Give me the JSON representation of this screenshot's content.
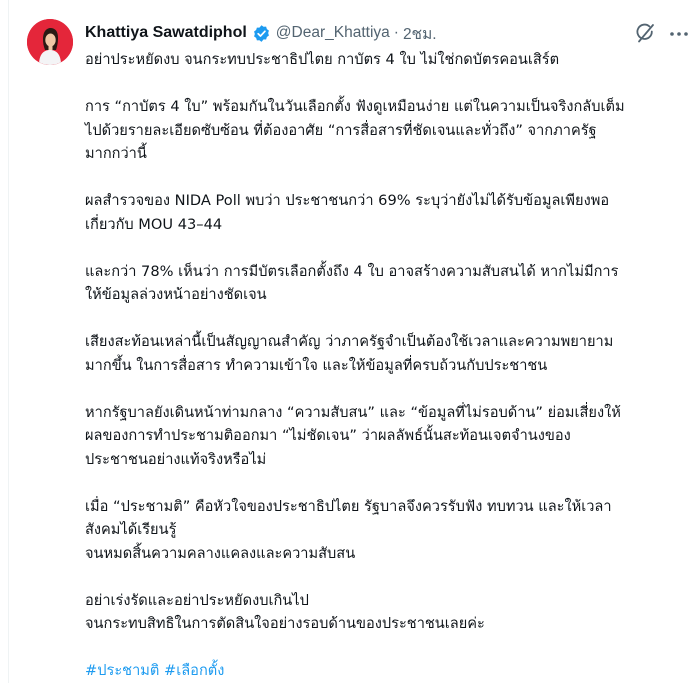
{
  "author": {
    "display_name": "Khattiya Sawatdiphol",
    "handle": "@Dear_Khattiya",
    "separator": "·",
    "time": "2ชม.",
    "verified_icon": "verified-badge-icon",
    "avatar_bg": "#e4263a"
  },
  "actions": {
    "grok_icon": "grok-icon",
    "more_icon": "more-icon"
  },
  "tweet": {
    "paragraphs": [
      [
        "อย่าประหยัดงบ จนกระทบประชาธิปไตย กาบัตร 4 ใบ ไม่ใช่กดบัตรคอนเสิร์ต"
      ],
      [
        "การ “กาบัตร 4 ใบ” พร้อมกันในวันเลือกตั้ง ฟังดูเหมือนง่าย แต่ในความเป็นจริงกลับเต็ม",
        "ไปด้วยรายละเอียดซับซ้อน ที่ต้องอาศัย “การสื่อสารที่ชัดเจนและทั่วถึง” จากภาครัฐ",
        "มากกว่านี้"
      ],
      [
        "ผลสำรวจของ NIDA Poll พบว่า ประชาชนกว่า 69% ระบุว่ายังไม่ได้รับข้อมูลเพียงพอ",
        "เกี่ยวกับ MOU 43–44"
      ],
      [
        "และกว่า 78% เห็นว่า การมีบัตรเลือกตั้งถึง 4 ใบ อาจสร้างความสับสนได้ หากไม่มีการ",
        "ให้ข้อมูลล่วงหน้าอย่างชัดเจน"
      ],
      [
        "เสียงสะท้อนเหล่านี้เป็นสัญญาณสำคัญ ว่าภาครัฐจำเป็นต้องใช้เวลาและความพยายาม",
        "มากขึ้น ในการสื่อสาร ทำความเข้าใจ และให้ข้อมูลที่ครบถ้วนกับประชาชน"
      ],
      [
        "หากรัฐบาลยังเดินหน้าท่ามกลาง “ความสับสน” และ “ข้อมูลที่ไม่รอบด้าน” ย่อมเสี่ยงให้",
        "ผลของการทำประชามติออกมา “ไม่ชัดเจน” ว่าผลลัพธ์นั้นสะท้อนเจตจำนงของ",
        "ประชาชนอย่างแท้จริงหรือไม่"
      ],
      [
        "เมื่อ “ประชามติ” คือหัวใจของประชาธิปไตย รัฐบาลจึงควรรับฟัง ทบทวน และให้เวลา",
        "สังคมได้เรียนรู้",
        "จนหมดสิ้นความคลางแคลงและความสับสน"
      ],
      [
        "อย่าเร่งรัดและอย่าประหยัดงบเกินไป",
        "จนกระทบสิทธิในการตัดสินใจอย่างรอบด้านของประชาชนเลยค่ะ"
      ]
    ],
    "hashtags": [
      "#ประชามติ",
      "#เลือกตั้ง"
    ],
    "link_color": "#1d9bf0"
  }
}
